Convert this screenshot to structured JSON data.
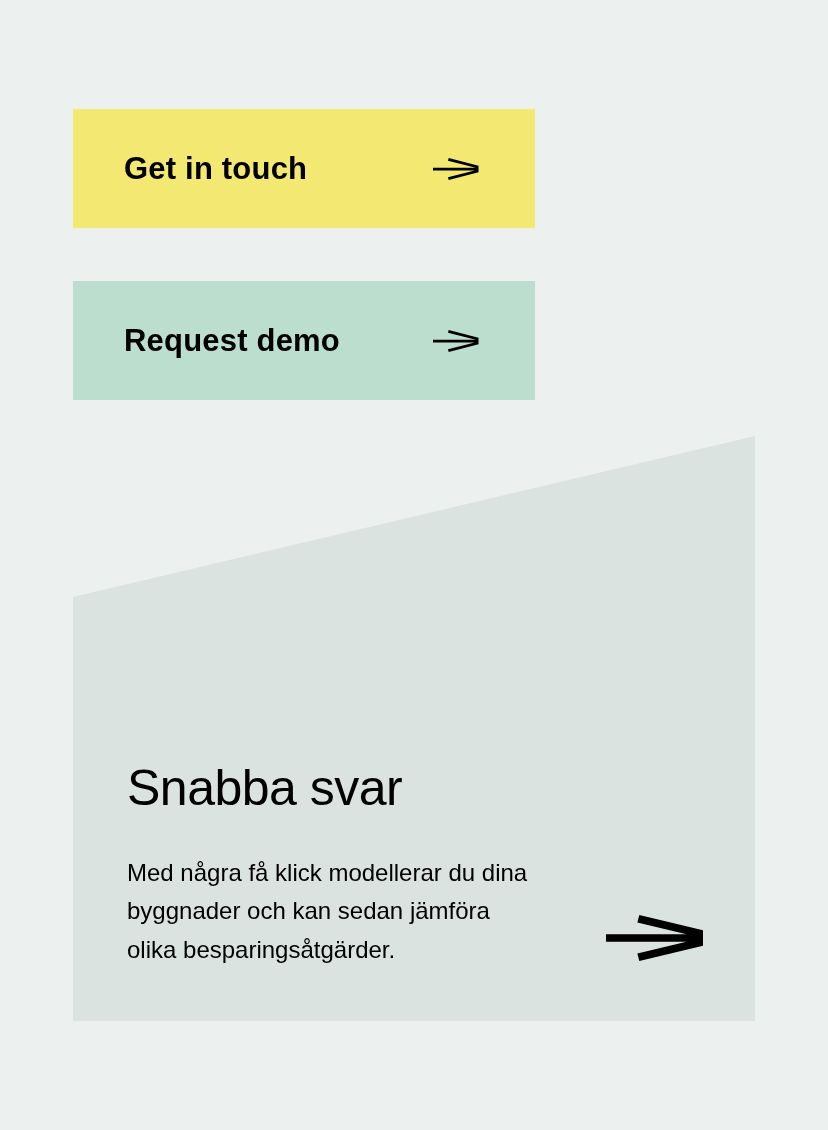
{
  "buttons": [
    {
      "label": "Get in touch",
      "color": "#f2e872"
    },
    {
      "label": "Request demo",
      "color": "#bcdecf"
    }
  ],
  "card": {
    "title": "Snabba svar",
    "text": "Med några få klick modellerar du dina byggnader och kan sedan jämföra olika besparingsåtgärder."
  }
}
